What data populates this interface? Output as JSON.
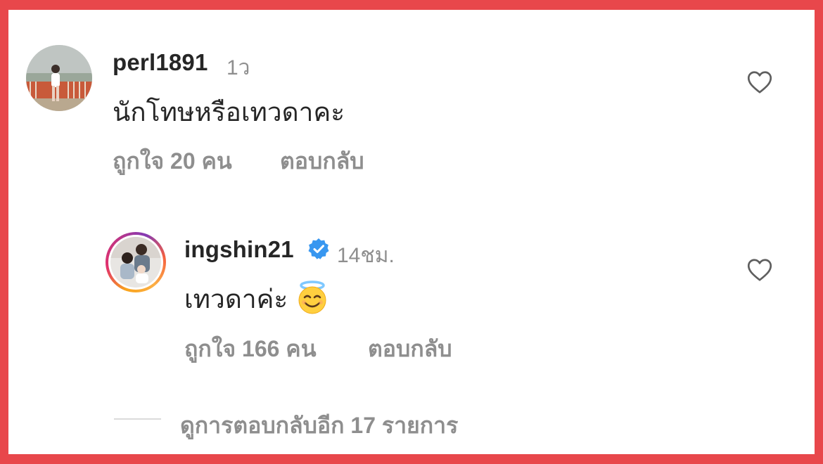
{
  "comments": [
    {
      "username": "perl1891",
      "time": "1ว",
      "text": "นักโทษหรือเทวดาคะ",
      "likes": "ถูกใจ 20 คน",
      "reply": "ตอบกลับ",
      "verified": false
    },
    {
      "username": "ingshin21",
      "time": "14ชม.",
      "text": "เทวดาค่ะ",
      "emoji": "smiling-face-with-halo",
      "likes": "ถูกใจ 166 คน",
      "reply": "ตอบกลับ",
      "verified": true
    }
  ],
  "view_more_replies": "ดูการตอบกลับอีก 17 รายการ",
  "colors": {
    "frame": "#e8474b",
    "verified": "#3897f0",
    "muted": "#8e8e8e",
    "text": "#262626"
  }
}
